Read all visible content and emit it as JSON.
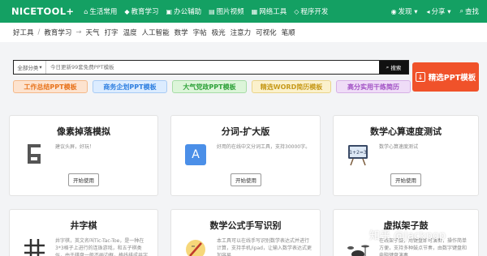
{
  "nav": {
    "logo": "NICETOOL+",
    "items": [
      {
        "icon": "home-icon",
        "glyph": "⌂",
        "label": "生活常用"
      },
      {
        "icon": "graduation-cap-icon",
        "glyph": "◆",
        "label": "教育学习"
      },
      {
        "icon": "office-icon",
        "glyph": "▣",
        "label": "办公辅助"
      },
      {
        "icon": "image-icon",
        "glyph": "▤",
        "label": "图片视频"
      },
      {
        "icon": "network-icon",
        "glyph": "▦",
        "label": "网络工具"
      },
      {
        "icon": "code-icon",
        "glyph": "◇",
        "label": "程序开发"
      }
    ],
    "right": [
      {
        "icon": "discover-icon",
        "glyph": "◉",
        "label": "发现 ▾"
      },
      {
        "icon": "share-icon",
        "glyph": "◂",
        "label": "分享 ▾"
      },
      {
        "icon": "search-icon",
        "glyph": "⌕",
        "label": "查找"
      }
    ]
  },
  "breadcrumb": {
    "home": "好工具",
    "section": "教育学习",
    "tags": [
      "天气",
      "打字",
      "温度",
      "人工智能",
      "数学",
      "字帖",
      "极光",
      "注意力",
      "可视化",
      "笔顺"
    ]
  },
  "search": {
    "category": "全部分类",
    "placeholder": "今日更新99套免费PPT模板",
    "button": "搜索"
  },
  "promo_button": "精选PPT模板",
  "promo_tags": [
    {
      "label": "工作总结PPT模板",
      "bg": "#fde3cf",
      "fg": "#e8731b",
      "border": "#f4b98a"
    },
    {
      "label": "商务企划PPT模板",
      "bg": "#dcecff",
      "fg": "#2f7fe0",
      "border": "#a8cbf4"
    },
    {
      "label": "大气党政PPT模板",
      "bg": "#dcf5d9",
      "fg": "#2fa23a",
      "border": "#a6dca6"
    },
    {
      "label": "精选WORD简历模板",
      "bg": "#fbf1cc",
      "fg": "#c79a1a",
      "border": "#ead48a"
    },
    {
      "label": "高分实用干练简历",
      "bg": "#efdcf7",
      "fg": "#a04fc4",
      "border": "#d6b0e6"
    }
  ],
  "cards": [
    {
      "title": "像素掉落模拟",
      "desc": "建议头屏，好玩！",
      "button": "开始使用",
      "icon": "pixel-six-icon"
    },
    {
      "title": "分词-扩大版",
      "desc": "好用的在线中文分词工具，支持30000字。",
      "button": "开始使用",
      "icon": "letter-a-icon"
    },
    {
      "title": "数学心算速度测试",
      "desc": "数学心算速度测试",
      "button": "开始使用",
      "icon": "math-board-icon"
    },
    {
      "title": "井字棋",
      "desc": "井字棋，英文名叫Tic-Tac-Toe，是一种在3*3格子上进行的连珠游戏，和五子棋类似，由于棋盘一般不画边框，格线排成井字",
      "button": "",
      "icon": "tic-tac-toe-icon"
    },
    {
      "title": "数学公式手写识别",
      "desc": "本工具可以在线手写识别数学表达式并进行计算，支持手机/ipad，让输入数学表达式更加容易",
      "button": "",
      "icon": "handwriting-icon"
    },
    {
      "title": "虚拟架子鼓",
      "desc": "在线架子鼓，用键盘即可演奏，操作简单方便，支持多种鼓点节奏，由数字键盘和电脑键盘演奏",
      "button": "",
      "icon": "drum-kit-icon"
    }
  ],
  "watermark": "知乎 @Jackpop"
}
